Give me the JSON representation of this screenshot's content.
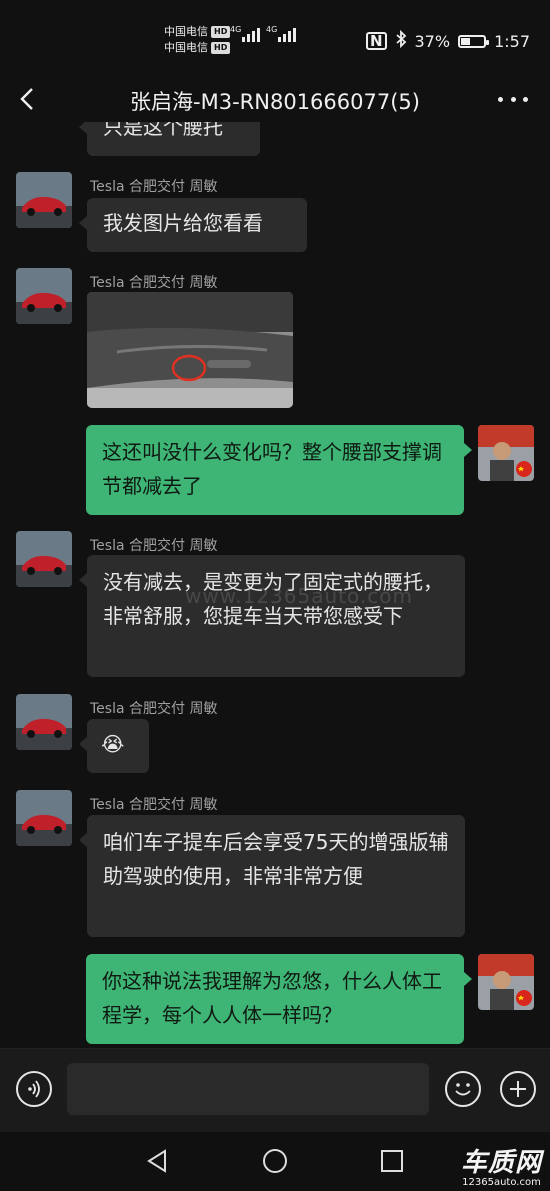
{
  "status_bar": {
    "carrier_1": "中国电信",
    "carrier_2": "中国电信",
    "hd_badge": "HD",
    "network_1": "4G",
    "network_2": "4G",
    "battery_percent": "37%",
    "time": "1:57"
  },
  "header": {
    "title": "张启海-M3-RN801666077(5)"
  },
  "messages": [
    {
      "direction": "in",
      "text": "只是这个腰托"
    },
    {
      "direction": "in",
      "sender": "Tesla 合肥交付 周敏",
      "text": "我发图片给您看看"
    },
    {
      "direction": "in",
      "sender": "Tesla 合肥交付 周敏",
      "type": "image",
      "image_desc": "seat-side-photo"
    },
    {
      "direction": "out",
      "text": "这还叫没什么变化吗？整个腰部支撑调节都减去了"
    },
    {
      "direction": "in",
      "sender": "Tesla 合肥交付 周敏",
      "text": "没有减去，是变更为了固定式的腰托，非常舒服，您提车当天带您感受下"
    },
    {
      "direction": "in",
      "sender": "Tesla 合肥交付 周敏",
      "text": "😭"
    },
    {
      "direction": "in",
      "sender": "Tesla 合肥交付 周敏",
      "text": "咱们车子提车后会享受75天的增强版辅助驾驶的使用，非常非常方便"
    },
    {
      "direction": "out",
      "text": "你这种说法我理解为忽悠，什么人体工程学，每个人人体一样吗？"
    }
  ],
  "watermark": "www.12365auto.com",
  "brand": {
    "name": "车质网",
    "url": "12365auto.com"
  },
  "colors": {
    "outgoing_bubble": "#3eb575",
    "incoming_bubble": "#2c2c2c",
    "background": "#111111"
  }
}
